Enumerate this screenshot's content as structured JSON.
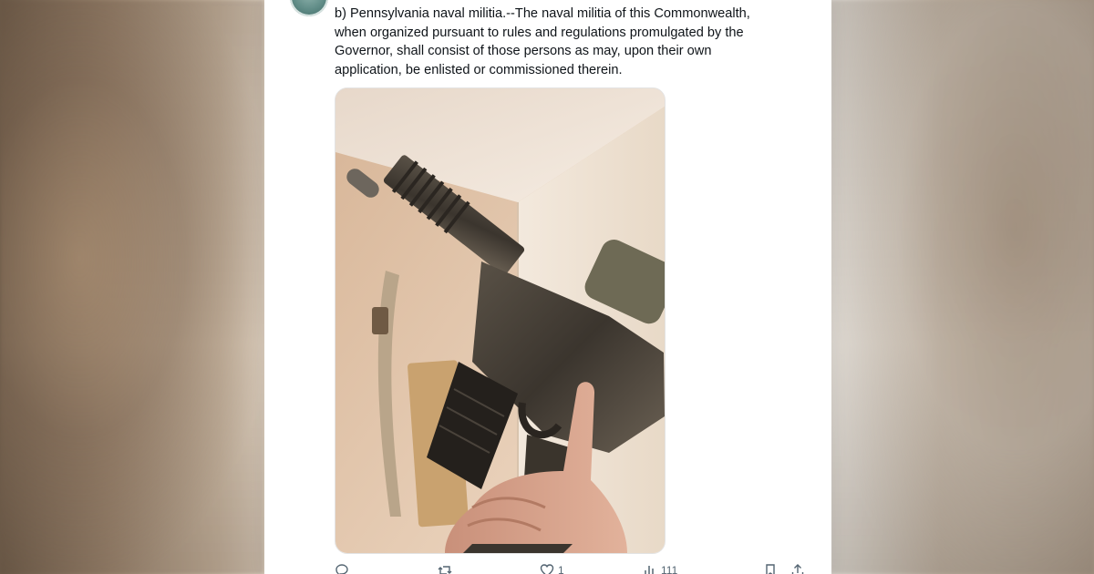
{
  "tweet": {
    "text_lines": [
      "b)  Pennsylvania naval militia.--The naval militia of this Commonwealth,",
      "when organized pursuant to rules and regulations promulgated by the",
      "Governor, shall consist of those persons as may, upon their own",
      "application, be enlisted or commissioned therein."
    ],
    "media": {
      "description_icon": "photo-rifle-image"
    },
    "actions": {
      "reply_icon": "reply-icon",
      "retweet_icon": "retweet-icon",
      "like_icon": "heart-icon",
      "like_count": "1",
      "views_icon": "views-bar-chart-icon",
      "views_count": "111",
      "bookmark_icon": "bookmark-icon",
      "share_icon": "share-icon"
    }
  },
  "colors": {
    "text": "#0f1419",
    "muted": "#536471",
    "card_bg": "#ffffff"
  }
}
